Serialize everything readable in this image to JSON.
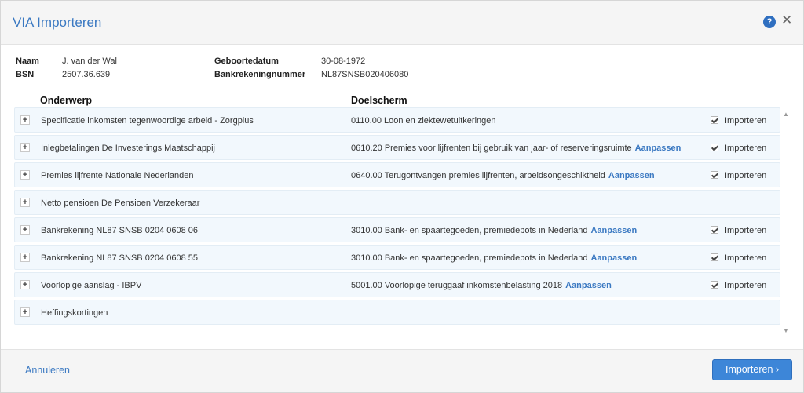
{
  "dialog": {
    "title": "VIA Importeren",
    "help_icon_glyph": "?",
    "close_icon_glyph": "✕"
  },
  "person": {
    "name_label": "Naam",
    "name_value": "J. van der Wal",
    "bsn_label": "BSN",
    "bsn_value": "2507.36.639",
    "dob_label": "Geboortedatum",
    "dob_value": "30-08-1972",
    "bank_label": "Bankrekeningnummer",
    "bank_value": "NL87SNSB020406080"
  },
  "table": {
    "col_subject": "Onderwerp",
    "col_target": "Doelscherm",
    "rows": [
      {
        "subject": "Specificatie inkomsten tegenwoordige arbeid - Zorgplus",
        "target": "0110.00 Loon en ziektewetuitkeringen",
        "adjust": "",
        "import_label": "Importeren",
        "checked": true
      },
      {
        "subject": "Inlegbetalingen De Investerings Maatschappij",
        "target": "0610.20 Premies voor lijfrenten bij gebruik van jaar- of reserveringsruimte",
        "adjust": "Aanpassen",
        "import_label": "Importeren",
        "checked": true
      },
      {
        "subject": "Premies lijfrente Nationale Nederlanden",
        "target": "0640.00 Terugontvangen premies lijfrenten, arbeidsongeschiktheid",
        "adjust": "Aanpassen",
        "import_label": "Importeren",
        "checked": true
      },
      {
        "subject": "Netto pensioen De Pensioen Verzekeraar",
        "target": "",
        "adjust": "",
        "import_label": "",
        "checked": false
      },
      {
        "subject": "Bankrekening NL87 SNSB 0204 0608 06",
        "target": "3010.00 Bank- en spaartegoeden, premiedepots in Nederland",
        "adjust": "Aanpassen",
        "import_label": "Importeren",
        "checked": true
      },
      {
        "subject": "Bankrekening NL87 SNSB 0204 0608 55",
        "target": "3010.00 Bank- en spaartegoeden, premiedepots in Nederland",
        "adjust": "Aanpassen",
        "import_label": "Importeren",
        "checked": true
      },
      {
        "subject": "Voorlopige aanslag - IBPV",
        "target": "5001.00 Voorlopige teruggaaf inkomstenbelasting 2018",
        "adjust": "Aanpassen",
        "import_label": "Importeren",
        "checked": true
      },
      {
        "subject": "Heffingskortingen",
        "target": "",
        "adjust": "",
        "import_label": "",
        "checked": false
      }
    ]
  },
  "footer": {
    "cancel_label": "Annuleren",
    "import_label": "Importeren ›"
  },
  "colors": {
    "accent": "#3b79c2",
    "button": "#3d86d8",
    "row_bg": "#f2f8fd"
  }
}
